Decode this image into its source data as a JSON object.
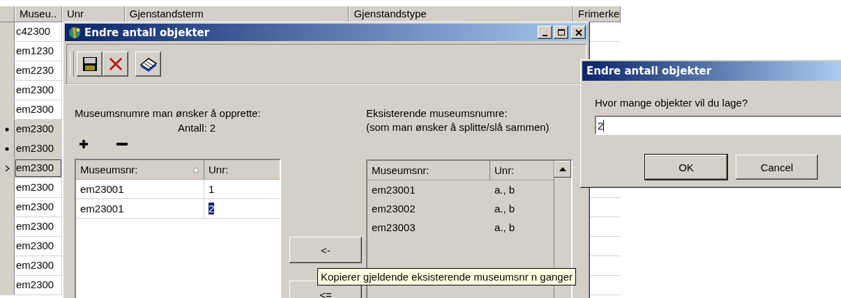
{
  "background_grid": {
    "columns": [
      "Museu..",
      "Unr",
      "Gjenstandsterm",
      "Gjenstandstype",
      "Frimerke"
    ],
    "rows": [
      {
        "cell": "c42300",
        "marked": false,
        "current": false,
        "selected": false
      },
      {
        "cell": "em1230",
        "marked": false,
        "current": false,
        "selected": false
      },
      {
        "cell": "em2230",
        "marked": false,
        "current": false,
        "selected": false
      },
      {
        "cell": "em2300",
        "marked": false,
        "current": false,
        "selected": false
      },
      {
        "cell": "em2300",
        "marked": false,
        "current": false,
        "selected": false
      },
      {
        "cell": "em2300",
        "marked": true,
        "current": false,
        "selected": true
      },
      {
        "cell": "em2300",
        "marked": true,
        "current": false,
        "selected": true
      },
      {
        "cell": "em2300",
        "marked": false,
        "current": true,
        "selected": true
      },
      {
        "cell": "em2300",
        "marked": false,
        "current": false,
        "selected": false
      },
      {
        "cell": "em2300",
        "marked": false,
        "current": false,
        "selected": false
      },
      {
        "cell": "em2300",
        "marked": false,
        "current": false,
        "selected": false
      },
      {
        "cell": "em2300",
        "marked": false,
        "current": false,
        "selected": false
      },
      {
        "cell": "em2300",
        "marked": false,
        "current": false,
        "selected": false
      },
      {
        "cell": "em2300",
        "marked": false,
        "current": false,
        "selected": false
      }
    ]
  },
  "main_dialog": {
    "title": "Endre antall objekter",
    "toolbar": [
      {
        "kind": "save"
      },
      {
        "kind": "delete"
      },
      {
        "kind": "book"
      }
    ],
    "new_label": "Museumsnumre man ønsker å opprette:",
    "count_label": "Antall: 2",
    "new_table": {
      "columns": [
        "Museumsnr:",
        "Unr:"
      ],
      "rows": [
        {
          "museumsnr": "em23001",
          "unr": "1",
          "selected": false
        },
        {
          "museumsnr": "em23001",
          "unr": "2",
          "selected": true
        }
      ]
    },
    "existing_label": "Eksisterende museumsnumre:",
    "existing_hint": "(som man ønsker å splitte/slå sammen)",
    "existing_table": {
      "columns": [
        "Museumsnr:",
        "Unr:"
      ],
      "rows": [
        {
          "museumsnr": "em23001",
          "unr": "a., b"
        },
        {
          "museumsnr": "em23002",
          "unr": "a., b"
        },
        {
          "museumsnr": "em23003",
          "unr": "a., b"
        }
      ]
    },
    "buttons": [
      "<-",
      "<="
    ],
    "tooltip": "Kopierer gjeldende eksisterende museumsnr n ganger"
  },
  "prompt_dialog": {
    "title": "Endre antall objekter",
    "question": "Hvor mange objekter vil du lage?",
    "value": "2",
    "buttons": [
      {
        "label": "OK",
        "default": true
      },
      {
        "label": "Cancel",
        "default": false
      }
    ]
  }
}
